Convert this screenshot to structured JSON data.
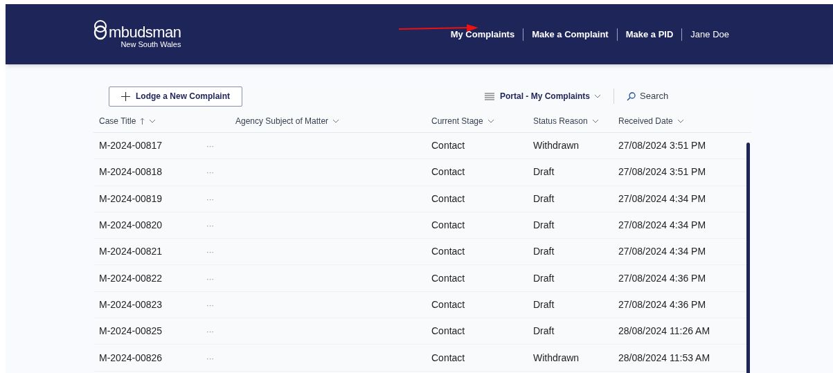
{
  "header": {
    "logo": {
      "title": "mbudsman",
      "subtitle": "New South Wales"
    },
    "nav": [
      {
        "label": "My Complaints",
        "kind": "link"
      },
      {
        "label": "Make a Complaint",
        "kind": "link"
      },
      {
        "label": "Make a PID",
        "kind": "link"
      },
      {
        "label": "Jane Doe",
        "kind": "user"
      }
    ]
  },
  "toolbar": {
    "new_button": "Lodge a New Complaint",
    "view": "Portal - My Complaints",
    "search": {
      "placeholder": "Search"
    }
  },
  "table": {
    "columns": [
      {
        "label": "Case Title",
        "sorted": true
      },
      {
        "label": "Agency Subject of Matter",
        "sorted": false
      },
      {
        "label": "Current Stage",
        "sorted": false
      },
      {
        "label": "Status Reason",
        "sorted": false
      },
      {
        "label": "Received Date",
        "sorted": false
      }
    ],
    "rows": [
      {
        "case": "M-2024-00817",
        "more": "···",
        "stage": "Contact",
        "status": "Withdrawn",
        "date": "27/08/2024 3:51 PM"
      },
      {
        "case": "M-2024-00818",
        "more": "···",
        "stage": "Contact",
        "status": "Draft",
        "date": "27/08/2024 3:51 PM"
      },
      {
        "case": "M-2024-00819",
        "more": "···",
        "stage": "Contact",
        "status": "Draft",
        "date": "27/08/2024 4:34 PM"
      },
      {
        "case": "M-2024-00820",
        "more": "···",
        "stage": "Contact",
        "status": "Draft",
        "date": "27/08/2024 4:34 PM"
      },
      {
        "case": "M-2024-00821",
        "more": "···",
        "stage": "Contact",
        "status": "Draft",
        "date": "27/08/2024 4:34 PM"
      },
      {
        "case": "M-2024-00822",
        "more": "···",
        "stage": "Contact",
        "status": "Draft",
        "date": "27/08/2024 4:36 PM"
      },
      {
        "case": "M-2024-00823",
        "more": "···",
        "stage": "Contact",
        "status": "Draft",
        "date": "27/08/2024 4:36 PM"
      },
      {
        "case": "M-2024-00825",
        "more": "···",
        "stage": "Contact",
        "status": "Draft",
        "date": "28/08/2024 11:26 AM"
      },
      {
        "case": "M-2024-00826",
        "more": "···",
        "stage": "Contact",
        "status": "Withdrawn",
        "date": "28/08/2024 11:53 AM"
      }
    ]
  }
}
